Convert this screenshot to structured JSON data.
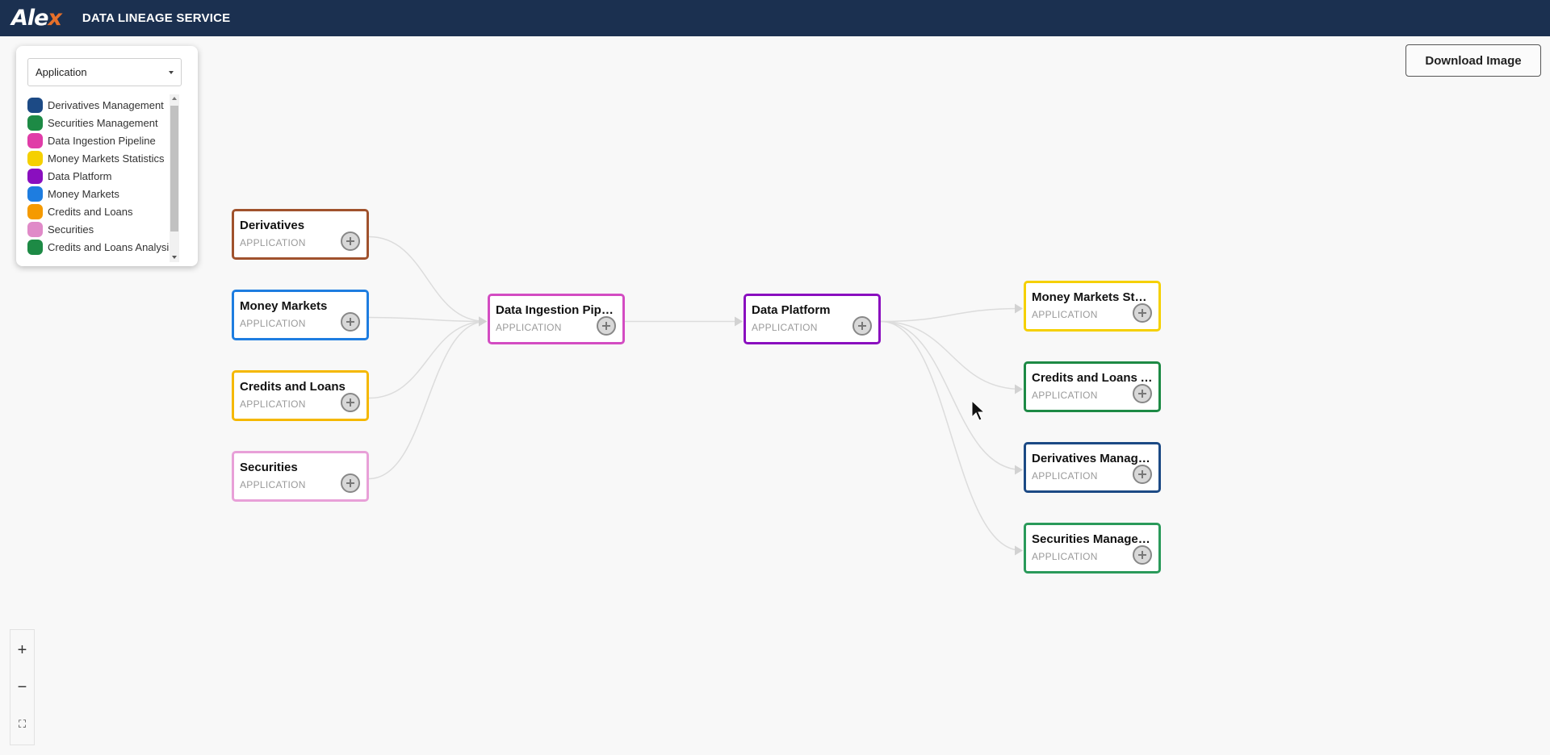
{
  "header": {
    "logo_text": "Ale",
    "logo_accent": "x",
    "title": "DATA LINEAGE SERVICE"
  },
  "legend": {
    "selected": "Application",
    "items": [
      {
        "label": "Derivatives Management",
        "color": "#1c4a85"
      },
      {
        "label": "Securities Management",
        "color": "#1d8a45"
      },
      {
        "label": "Data Ingestion Pipeline",
        "color": "#e03ca8"
      },
      {
        "label": "Money Markets Statistics",
        "color": "#f5d000"
      },
      {
        "label": "Data Platform",
        "color": "#8a0fbf"
      },
      {
        "label": "Money Markets",
        "color": "#1e7de0"
      },
      {
        "label": "Credits and Loans",
        "color": "#f59a00"
      },
      {
        "label": "Securities",
        "color": "#e08ac8"
      },
      {
        "label": "Credits and Loans Analysis",
        "color": "#1d8a45"
      },
      {
        "label": "",
        "color": "#a0522d"
      }
    ]
  },
  "toolbar": {
    "download_label": "Download Image"
  },
  "nodes": [
    {
      "id": "derivatives",
      "name": "Derivatives",
      "type": "APPLICATION",
      "color": "#a0522d"
    },
    {
      "id": "money-markets",
      "name": "Money Markets",
      "type": "APPLICATION",
      "color": "#1e7de0"
    },
    {
      "id": "credits-loans",
      "name": "Credits and Loans",
      "type": "APPLICATION",
      "color": "#f5b800"
    },
    {
      "id": "securities",
      "name": "Securities",
      "type": "APPLICATION",
      "color": "#e8a0d8"
    },
    {
      "id": "data-ingestion",
      "name": "Data Ingestion Pipeline",
      "type": "APPLICATION",
      "color": "#d34cc2"
    },
    {
      "id": "data-platform",
      "name": "Data Platform",
      "type": "APPLICATION",
      "color": "#8a0fbf"
    },
    {
      "id": "mm-statistics",
      "name": "Money Markets Statistics",
      "type": "APPLICATION",
      "color": "#f5d000"
    },
    {
      "id": "cl-analysis",
      "name": "Credits and Loans Analysis",
      "type": "APPLICATION",
      "color": "#1d8a45"
    },
    {
      "id": "deriv-mgmt",
      "name": "Derivatives Management",
      "type": "APPLICATION",
      "color": "#1c4a85"
    },
    {
      "id": "sec-mgmt",
      "name": "Securities Management",
      "type": "APPLICATION",
      "color": "#2a9a5a"
    }
  ],
  "edges": [
    {
      "from": "derivatives",
      "to": "data-ingestion"
    },
    {
      "from": "money-markets",
      "to": "data-ingestion"
    },
    {
      "from": "credits-loans",
      "to": "data-ingestion"
    },
    {
      "from": "securities",
      "to": "data-ingestion"
    },
    {
      "from": "data-ingestion",
      "to": "data-platform"
    },
    {
      "from": "data-platform",
      "to": "mm-statistics"
    },
    {
      "from": "data-platform",
      "to": "cl-analysis"
    },
    {
      "from": "data-platform",
      "to": "deriv-mgmt"
    },
    {
      "from": "data-platform",
      "to": "sec-mgmt"
    }
  ],
  "zoom_controls": {
    "zoom_in": "+",
    "zoom_out": "−",
    "fit": "⛶"
  }
}
